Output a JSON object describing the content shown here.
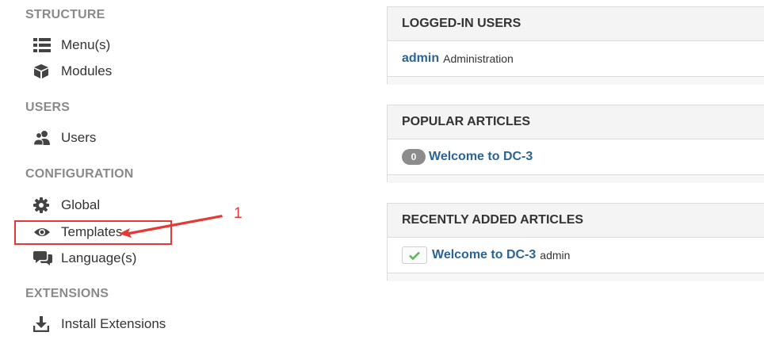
{
  "sidebar": {
    "sections": [
      {
        "heading": "STRUCTURE",
        "items": [
          {
            "label": "Menu(s)",
            "icon": "list-icon"
          },
          {
            "label": "Modules",
            "icon": "cube-icon"
          }
        ]
      },
      {
        "heading": "USERS",
        "items": [
          {
            "label": "Users",
            "icon": "users-icon"
          }
        ]
      },
      {
        "heading": "CONFIGURATION",
        "items": [
          {
            "label": "Global",
            "icon": "gear-icon"
          },
          {
            "label": "Templates",
            "icon": "eye-icon"
          },
          {
            "label": "Language(s)",
            "icon": "comments-icon"
          }
        ]
      },
      {
        "heading": "EXTENSIONS",
        "items": [
          {
            "label": "Install Extensions",
            "icon": "download-icon"
          }
        ]
      }
    ]
  },
  "annotation": {
    "number": "1",
    "color": "#e53935"
  },
  "panels": {
    "logged_in": {
      "title": "LOGGED-IN USERS",
      "user": "admin",
      "role": "Administration"
    },
    "popular": {
      "title": "POPULAR ARTICLES",
      "hits": "0",
      "article": "Welcome to DC-3"
    },
    "recent": {
      "title": "RECENTLY ADDED ARTICLES",
      "article": "Welcome to DC-3",
      "author": "admin"
    }
  },
  "colors": {
    "link": "#2a6496",
    "heading": "#8a8a8a",
    "check": "#5cb85c"
  }
}
